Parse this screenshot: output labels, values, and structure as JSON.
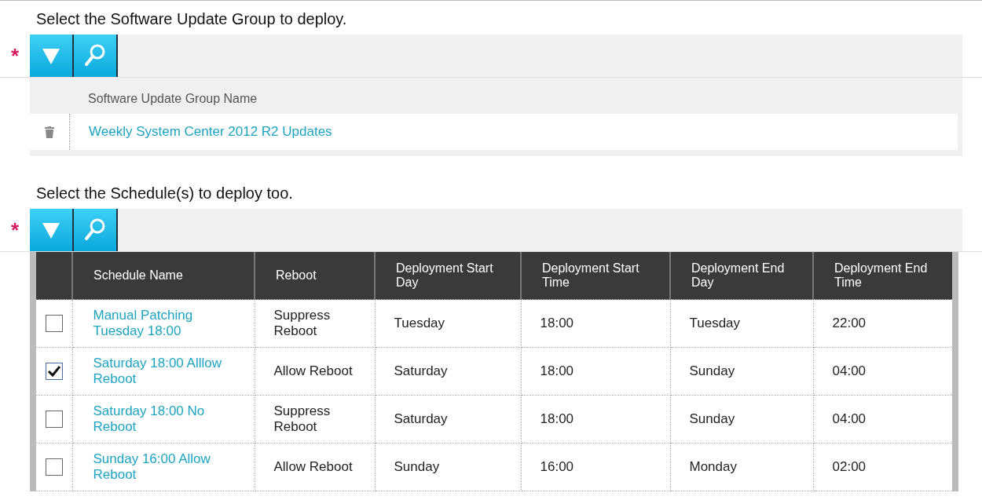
{
  "group_section": {
    "heading": "Select the Software Update Group to deploy.",
    "required_mark": "*",
    "column": "Software Update Group Name",
    "rows": [
      {
        "name": "Weekly System Center 2012 R2 Updates"
      }
    ]
  },
  "schedule_section": {
    "heading": "Select the Schedule(s) to deploy too.",
    "required_mark": "*",
    "columns": [
      "Schedule Name",
      "Reboot",
      "Deployment Start Day",
      "Deployment Start Time",
      "Deployment End Day",
      "Deployment End Time"
    ],
    "rows": [
      {
        "checked": false,
        "name": "Manual Patching Tuesday 18:00",
        "reboot": "Suppress Reboot",
        "start_day": "Tuesday",
        "start_time": "18:00",
        "end_day": "Tuesday",
        "end_time": "22:00"
      },
      {
        "checked": true,
        "name": "Saturday 18:00 Alllow Reboot",
        "reboot": "Allow Reboot",
        "start_day": "Saturday",
        "start_time": "18:00",
        "end_day": "Sunday",
        "end_time": "04:00"
      },
      {
        "checked": false,
        "name": "Saturday 18:00 No Reboot",
        "reboot": "Suppress Reboot",
        "start_day": "Saturday",
        "start_time": "18:00",
        "end_day": "Sunday",
        "end_time": "04:00"
      },
      {
        "checked": false,
        "name": "Sunday 16:00 Allow Reboot",
        "reboot": "Allow Reboot",
        "start_day": "Sunday",
        "start_time": "16:00",
        "end_day": "Monday",
        "end_time": "02:00"
      }
    ]
  }
}
